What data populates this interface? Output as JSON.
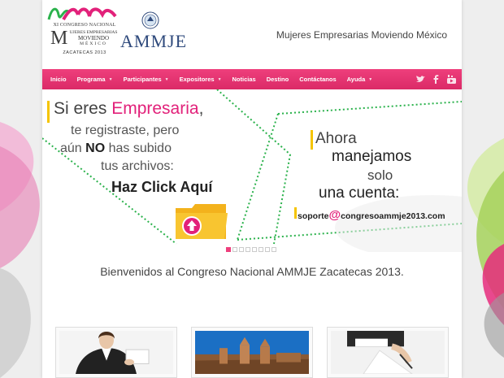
{
  "logo": {
    "congreso_line": "XI CONGRESO NACIONAL",
    "big_letter": "M",
    "sub_lines": [
      "UJERES EMPRESARIAS",
      "MOVIENDO",
      "MÉXICO"
    ],
    "city_line": "ZACATECAS 2013",
    "ammje": "AMMJE"
  },
  "header": {
    "tagline": "Mujeres Empresarias Moviendo México"
  },
  "nav": {
    "items": [
      {
        "label": "Inicio",
        "dropdown": false
      },
      {
        "label": "Programa",
        "dropdown": true
      },
      {
        "label": "Participantes",
        "dropdown": true
      },
      {
        "label": "Expositores",
        "dropdown": true
      },
      {
        "label": "Noticias",
        "dropdown": false
      },
      {
        "label": "Destino",
        "dropdown": false
      },
      {
        "label": "Contáctanos",
        "dropdown": false
      },
      {
        "label": "Ayuda",
        "dropdown": true
      }
    ],
    "social_icons": [
      "twitter-icon",
      "facebook-icon",
      "youtube-icon"
    ]
  },
  "slider": {
    "line1_a": "Si eres ",
    "line1_b": "Empresaria",
    "line1_c": ",",
    "line2": "te registraste, pero",
    "line3_a": "aún ",
    "line3_b": "NO",
    "line3_c": " has subido",
    "line4": "tus archivos:",
    "cta": "Haz Click Aquí",
    "right1": "Ahora",
    "right2": "manejamos",
    "right3": "solo",
    "right4": "una cuenta:",
    "email_a": "soporte",
    "email_at": "@",
    "email_b": "congresoammje2013.com",
    "slide_count": 8,
    "active_slide": 1
  },
  "welcome": {
    "text": "Bienvenidos al Congreso Nacional AMMJE Zacatecas 2013."
  },
  "colors": {
    "accent": "#e2217a",
    "nav": "#e8326f",
    "highlight": "#f5c400",
    "dotted_green": "#2bb24c"
  }
}
